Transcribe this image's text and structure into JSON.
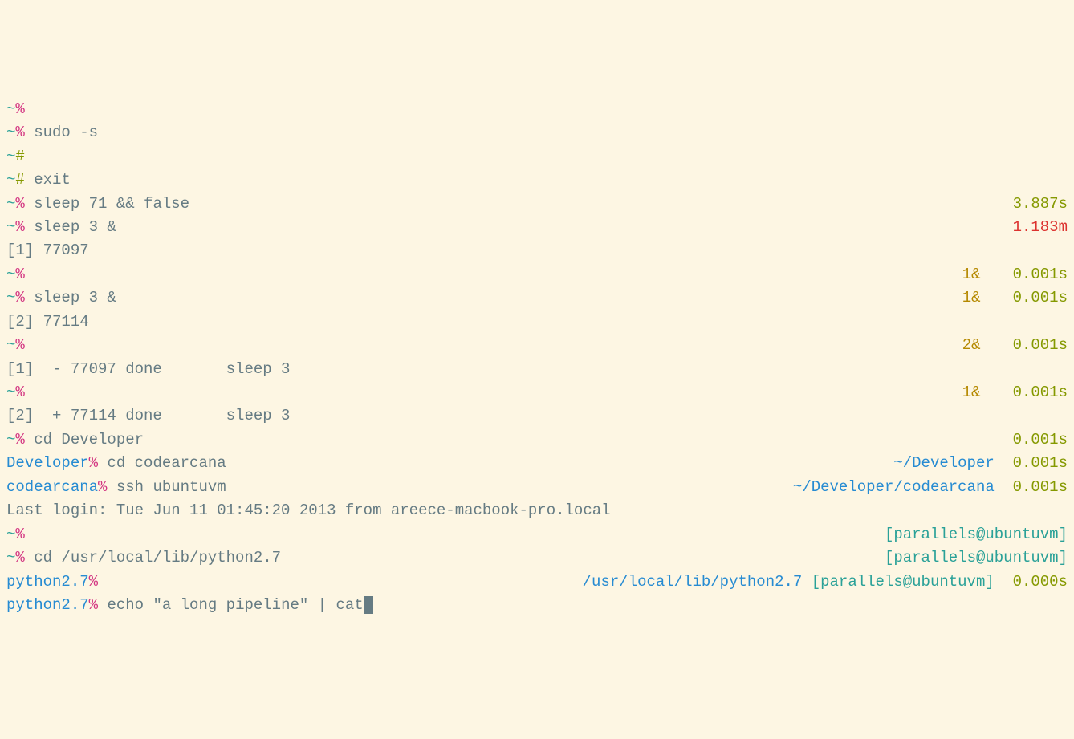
{
  "lines": [
    {
      "left": [
        {
          "t": "~",
          "c": "cyan"
        },
        {
          "t": "%",
          "c": "magenta"
        }
      ],
      "right": []
    },
    {
      "left": [
        {
          "t": "~",
          "c": "cyan"
        },
        {
          "t": "% ",
          "c": "magenta"
        },
        {
          "t": "sudo -s",
          "c": "base"
        }
      ],
      "right": []
    },
    {
      "left": [
        {
          "t": "~",
          "c": "cyan"
        },
        {
          "t": "#",
          "c": "olive"
        }
      ],
      "right": []
    },
    {
      "left": [
        {
          "t": "~",
          "c": "cyan"
        },
        {
          "t": "# ",
          "c": "olive"
        },
        {
          "t": "exit",
          "c": "base"
        }
      ],
      "right": []
    },
    {
      "left": [
        {
          "t": "~",
          "c": "cyan"
        },
        {
          "t": "% ",
          "c": "magenta"
        },
        {
          "t": "sleep 71 && false",
          "c": "base"
        }
      ],
      "right": [
        {
          "t": "3.887s",
          "c": "olive"
        }
      ]
    },
    {
      "left": [
        {
          "t": "~",
          "c": "cyan"
        },
        {
          "t": "% ",
          "c": "magenta"
        },
        {
          "t": "sleep 3 &",
          "c": "base"
        }
      ],
      "right": [
        {
          "t": "1.183m",
          "c": "red"
        }
      ]
    },
    {
      "left": [
        {
          "t": "[1] 77097",
          "c": "base"
        }
      ],
      "right": []
    },
    {
      "left": [
        {
          "t": "~",
          "c": "cyan"
        },
        {
          "t": "%",
          "c": "magenta"
        }
      ],
      "right": [
        {
          "t": "1&",
          "c": "jobs"
        },
        {
          "gap": true
        },
        {
          "t": "0.001s",
          "c": "olive"
        }
      ]
    },
    {
      "left": [
        {
          "t": "~",
          "c": "cyan"
        },
        {
          "t": "% ",
          "c": "magenta"
        },
        {
          "t": "sleep 3 &",
          "c": "base"
        }
      ],
      "right": [
        {
          "t": "1&",
          "c": "jobs"
        },
        {
          "gap": true
        },
        {
          "t": "0.001s",
          "c": "olive"
        }
      ]
    },
    {
      "left": [
        {
          "t": "[2] 77114",
          "c": "base"
        }
      ],
      "right": []
    },
    {
      "left": [
        {
          "t": "~",
          "c": "cyan"
        },
        {
          "t": "%",
          "c": "magenta"
        }
      ],
      "right": [
        {
          "t": "2&",
          "c": "jobs"
        },
        {
          "gap": true
        },
        {
          "t": "0.001s",
          "c": "olive"
        }
      ]
    },
    {
      "left": [
        {
          "t": "[1]  - 77097 done       sleep 3",
          "c": "base"
        }
      ],
      "right": []
    },
    {
      "left": [
        {
          "t": "~",
          "c": "cyan"
        },
        {
          "t": "%",
          "c": "magenta"
        }
      ],
      "right": [
        {
          "t": "1&",
          "c": "jobs"
        },
        {
          "gap": true
        },
        {
          "t": "0.001s",
          "c": "olive"
        }
      ]
    },
    {
      "left": [
        {
          "t": "[2]  + 77114 done       sleep 3",
          "c": "base"
        }
      ],
      "right": []
    },
    {
      "left": [
        {
          "t": "~",
          "c": "cyan"
        },
        {
          "t": "% ",
          "c": "magenta"
        },
        {
          "t": "cd Developer",
          "c": "base"
        }
      ],
      "right": [
        {
          "t": "0.001s",
          "c": "olive"
        }
      ]
    },
    {
      "left": [
        {
          "t": "Developer",
          "c": "blue"
        },
        {
          "t": "% ",
          "c": "magenta"
        },
        {
          "t": "cd codearcana",
          "c": "base"
        }
      ],
      "right": [
        {
          "t": "~/Developer",
          "c": "blue"
        },
        {
          "t": "  ",
          "c": "base"
        },
        {
          "t": "0.001s",
          "c": "olive"
        }
      ]
    },
    {
      "left": [
        {
          "t": "codearcana",
          "c": "blue"
        },
        {
          "t": "% ",
          "c": "magenta"
        },
        {
          "t": "ssh ubuntuvm",
          "c": "base"
        }
      ],
      "right": [
        {
          "t": "~/Developer/codearcana",
          "c": "blue"
        },
        {
          "t": "  ",
          "c": "base"
        },
        {
          "t": "0.001s",
          "c": "olive"
        }
      ]
    },
    {
      "left": [
        {
          "t": "Last login: Tue Jun 11 01:45:20 2013 from areece-macbook-pro.local",
          "c": "base"
        }
      ],
      "right": []
    },
    {
      "left": [
        {
          "t": "~",
          "c": "cyan"
        },
        {
          "t": "%",
          "c": "magenta"
        }
      ],
      "right": [
        {
          "t": "[parallels@ubuntuvm]",
          "c": "cyan"
        }
      ]
    },
    {
      "left": [
        {
          "t": "~",
          "c": "cyan"
        },
        {
          "t": "% ",
          "c": "magenta"
        },
        {
          "t": "cd /usr/local/lib/python2.7",
          "c": "base"
        }
      ],
      "right": [
        {
          "t": "[parallels@ubuntuvm]",
          "c": "cyan"
        }
      ]
    },
    {
      "left": [
        {
          "t": "python2.7",
          "c": "blue"
        },
        {
          "t": "%",
          "c": "magenta"
        }
      ],
      "right": [
        {
          "t": "/usr/local/lib/python2.7",
          "c": "blue"
        },
        {
          "t": " ",
          "c": "base"
        },
        {
          "t": "[parallels@ubuntuvm]",
          "c": "cyan"
        },
        {
          "t": "  ",
          "c": "base"
        },
        {
          "t": "0.000s",
          "c": "olive"
        }
      ]
    },
    {
      "left": [
        {
          "t": "python2.7",
          "c": "blue"
        },
        {
          "t": "% ",
          "c": "magenta"
        },
        {
          "t": "echo \"a long pipeline\" | cat",
          "c": "base"
        },
        {
          "cursor": true
        }
      ],
      "right": []
    }
  ]
}
